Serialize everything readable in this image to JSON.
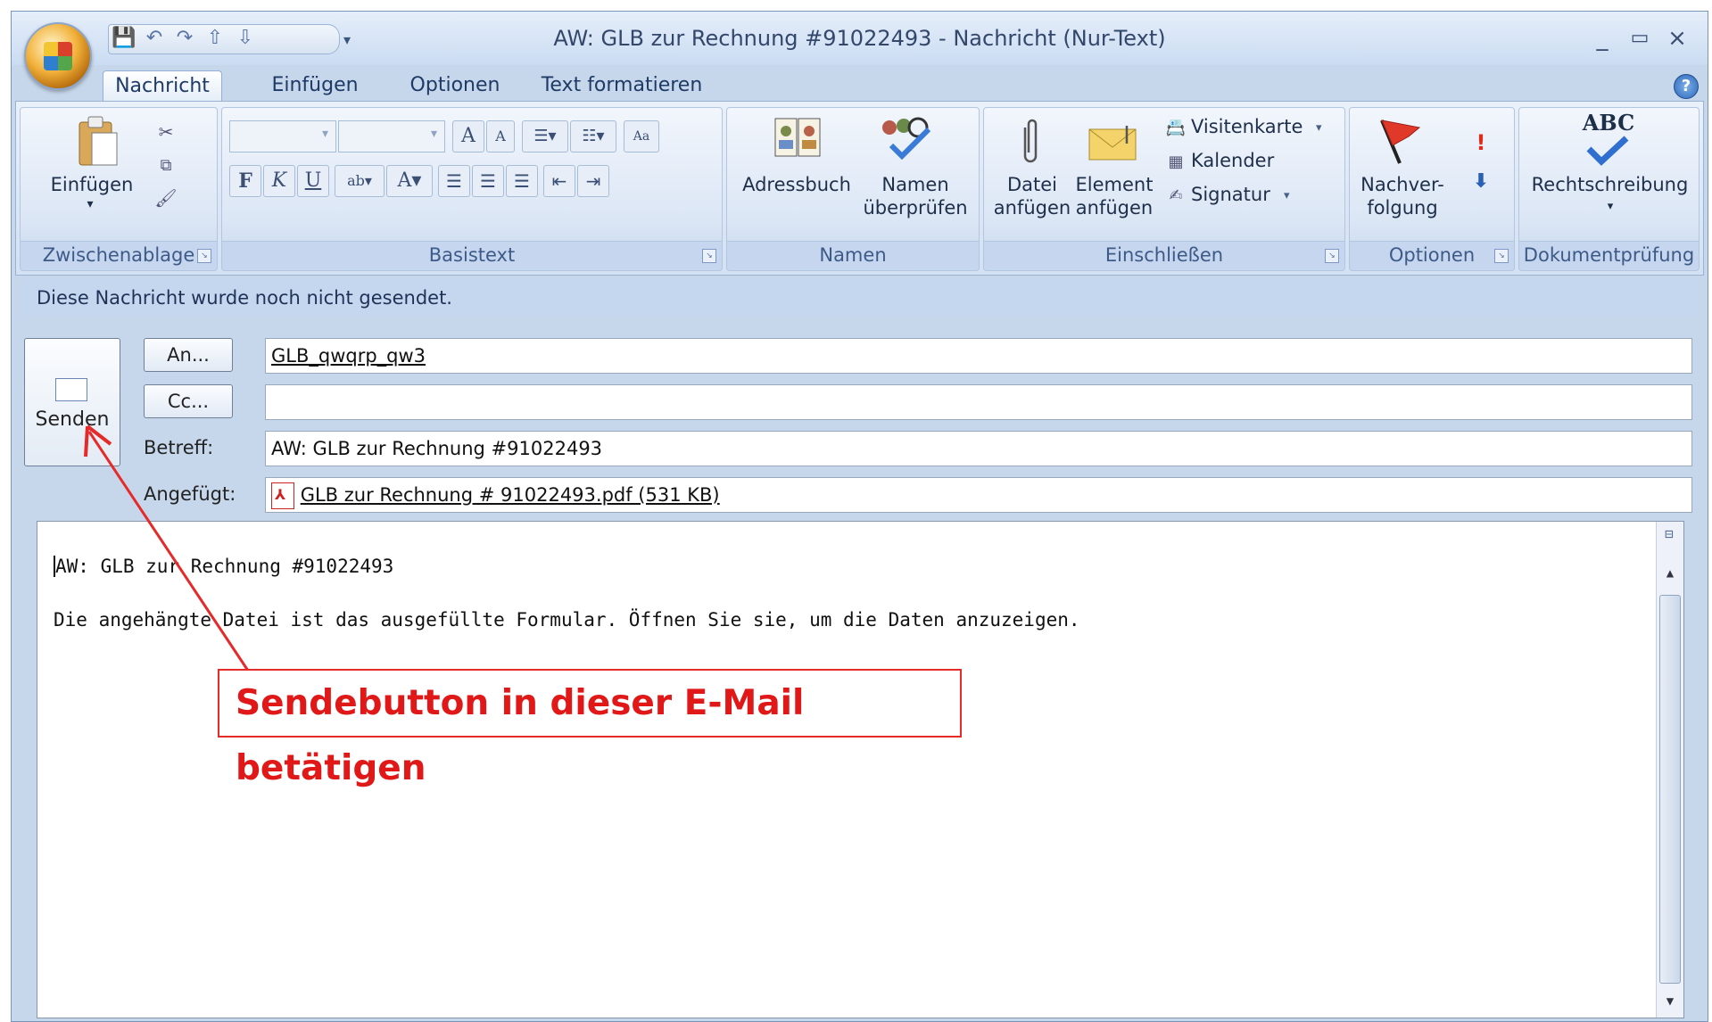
{
  "window": {
    "title": "AW: GLB zur Rechnung #91022493 - Nachricht (Nur-Text)",
    "controls": [
      "_",
      "▭",
      "×"
    ]
  },
  "tabs": [
    "Nachricht",
    "Einfügen",
    "Optionen",
    "Text formatieren"
  ],
  "ribbon": {
    "zwischenablage": {
      "label": "Zwischenablage",
      "paste": "Einfügen"
    },
    "basistext": {
      "label": "Basistext",
      "bold": "F",
      "italic": "K",
      "underline": "U"
    },
    "namen": {
      "label": "Namen",
      "adressbuch": "Adressbuch",
      "namen_pruefen_1": "Namen",
      "namen_pruefen_2": "überprüfen"
    },
    "einschliessen": {
      "label": "Einschließen",
      "datei_1": "Datei",
      "datei_2": "anfügen",
      "element_1": "Element",
      "element_2": "anfügen",
      "visitenkarte": "Visitenkarte",
      "kalender": "Kalender",
      "signatur": "Signatur"
    },
    "optionen": {
      "label": "Optionen",
      "nachverfolgung_1": "Nachver-",
      "nachverfolgung_2": "folgung"
    },
    "dokumentpruefung": {
      "label": "Dokumentprüfung",
      "rechtschreibung": "Rechtschreibung",
      "abc": "ABC"
    }
  },
  "compose": {
    "info": "Diese Nachricht wurde noch nicht gesendet.",
    "send": "Senden",
    "to_button": "An...",
    "cc_button": "Cc...",
    "to_value": "GLB_qwqrp_qw3",
    "cc_value": "",
    "subject_label": "Betreff:",
    "subject_value": "AW: GLB zur Rechnung #91022493",
    "attached_label": "Angefügt:",
    "attachment": "GLB zur Rechnung # 91022493.pdf (531 KB)"
  },
  "body": {
    "line1": "AW: GLB zur Rechnung #91022493",
    "line2": "Die angehängte Datei ist das ausgefüllte Formular. Öffnen Sie sie, um die Daten anzuzeigen."
  },
  "annotation": {
    "text": "Sendebutton in dieser E-Mail betätigen",
    "color": "#e01818"
  }
}
